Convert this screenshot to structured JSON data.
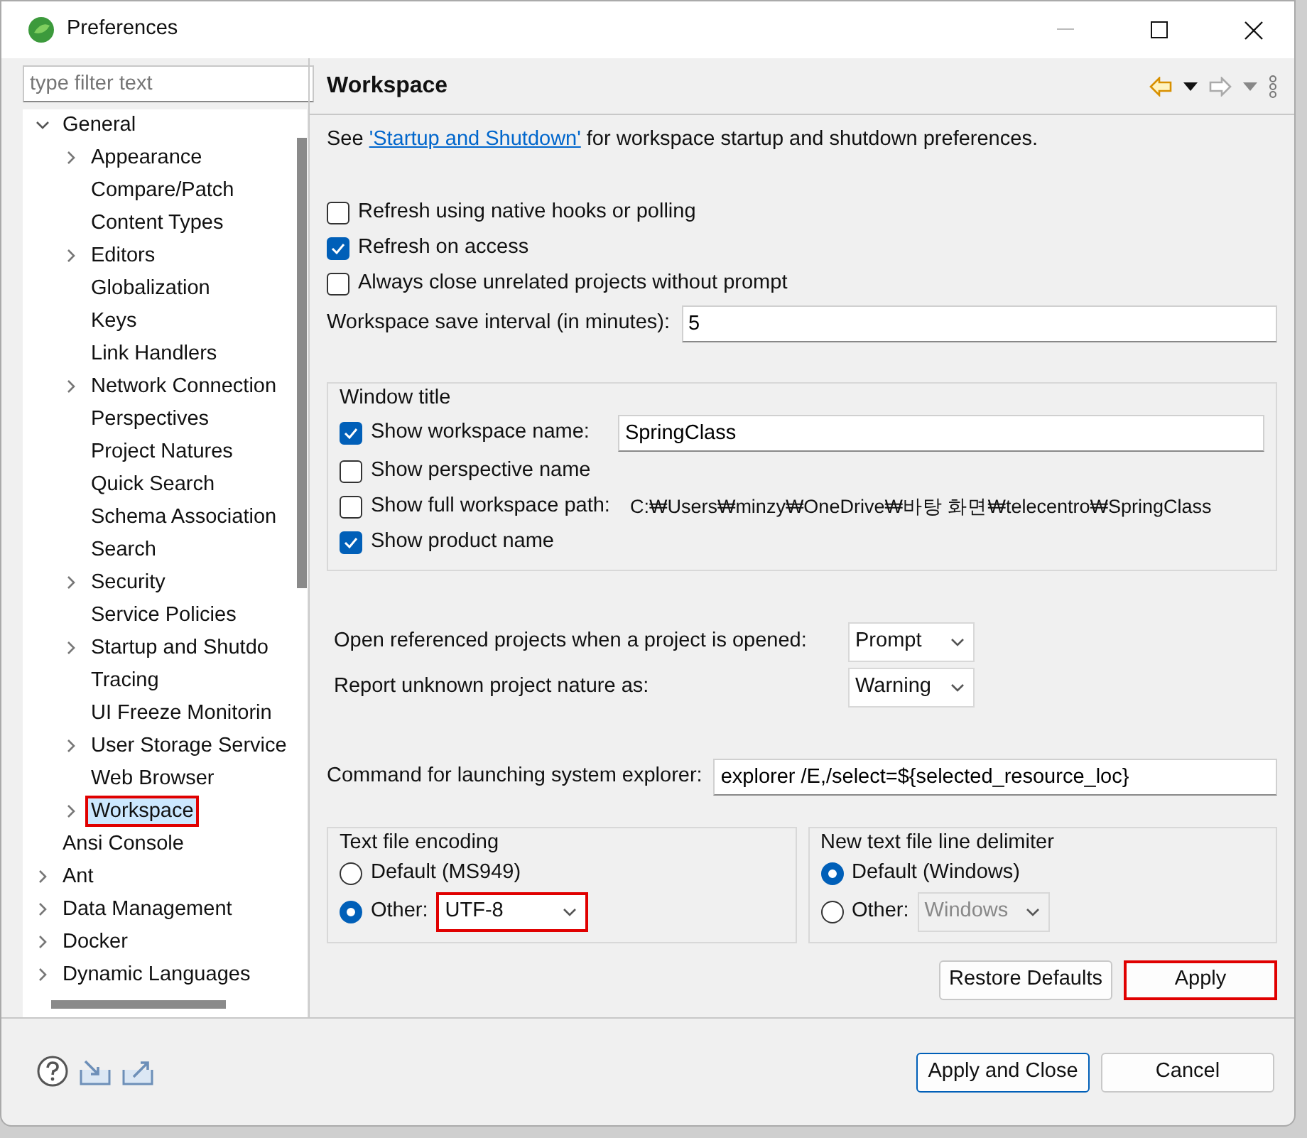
{
  "window": {
    "title": "Preferences"
  },
  "filter": {
    "placeholder": "type filter text"
  },
  "tree": [
    {
      "label": "General",
      "expandable": true,
      "expanded": true,
      "selected": false,
      "highlighted": false,
      "children": [
        {
          "label": "Appearance",
          "expandable": true,
          "expanded": false,
          "selected": false,
          "highlighted": false
        },
        {
          "label": "Compare/Patch",
          "expandable": false,
          "selected": false,
          "highlighted": false
        },
        {
          "label": "Content Types",
          "expandable": false,
          "selected": false,
          "highlighted": false
        },
        {
          "label": "Editors",
          "expandable": true,
          "expanded": false,
          "selected": false,
          "highlighted": false
        },
        {
          "label": "Globalization",
          "expandable": false,
          "selected": false,
          "highlighted": false
        },
        {
          "label": "Keys",
          "expandable": false,
          "selected": false,
          "highlighted": false
        },
        {
          "label": "Link Handlers",
          "expandable": false,
          "selected": false,
          "highlighted": false
        },
        {
          "label": "Network Connection",
          "expandable": true,
          "expanded": false,
          "selected": false,
          "highlighted": false
        },
        {
          "label": "Perspectives",
          "expandable": false,
          "selected": false,
          "highlighted": false
        },
        {
          "label": "Project Natures",
          "expandable": false,
          "selected": false,
          "highlighted": false
        },
        {
          "label": "Quick Search",
          "expandable": false,
          "selected": false,
          "highlighted": false
        },
        {
          "label": "Schema Association",
          "expandable": false,
          "selected": false,
          "highlighted": false
        },
        {
          "label": "Search",
          "expandable": false,
          "selected": false,
          "highlighted": false
        },
        {
          "label": "Security",
          "expandable": true,
          "expanded": false,
          "selected": false,
          "highlighted": false
        },
        {
          "label": "Service Policies",
          "expandable": false,
          "selected": false,
          "highlighted": false
        },
        {
          "label": "Startup and Shutdo",
          "expandable": true,
          "expanded": false,
          "selected": false,
          "highlighted": false
        },
        {
          "label": "Tracing",
          "expandable": false,
          "selected": false,
          "highlighted": false
        },
        {
          "label": "UI Freeze Monitorin",
          "expandable": false,
          "selected": false,
          "highlighted": false
        },
        {
          "label": "User Storage Service",
          "expandable": true,
          "expanded": false,
          "selected": false,
          "highlighted": false
        },
        {
          "label": "Web Browser",
          "expandable": false,
          "selected": false,
          "highlighted": false
        },
        {
          "label": "Workspace",
          "expandable": true,
          "expanded": false,
          "selected": true,
          "highlighted": true
        }
      ]
    },
    {
      "label": "Ansi Console",
      "expandable": false,
      "selected": false,
      "highlighted": false
    },
    {
      "label": "Ant",
      "expandable": true,
      "expanded": false,
      "selected": false,
      "highlighted": false
    },
    {
      "label": "Data Management",
      "expandable": true,
      "expanded": false,
      "selected": false,
      "highlighted": false
    },
    {
      "label": "Docker",
      "expandable": true,
      "expanded": false,
      "selected": false,
      "highlighted": false
    },
    {
      "label": "Dynamic Languages",
      "expandable": true,
      "expanded": false,
      "selected": false,
      "highlighted": false
    }
  ],
  "page": {
    "title": "Workspace",
    "intro": {
      "before": "See ",
      "link": "'Startup and Shutdown'",
      "after": " for workspace startup and shutdown preferences."
    },
    "options": [
      {
        "label": "Refresh using native hooks or polling",
        "checked": false
      },
      {
        "label": "Refresh on access",
        "checked": true
      },
      {
        "label": "Always close unrelated projects without prompt",
        "checked": false
      }
    ],
    "save_interval": {
      "label": "Workspace save interval (in minutes):",
      "value": "5"
    },
    "window_title": {
      "title": "Window title",
      "rows": [
        {
          "kind": "field",
          "label": "Show workspace name:",
          "checked": true,
          "value": "SpringClass"
        },
        {
          "kind": "plain",
          "label": "Show perspective name",
          "checked": false
        },
        {
          "kind": "path",
          "label": "Show full workspace path:",
          "checked": false,
          "value": "C:₩Users₩minzy₩OneDrive₩바탕 화면₩telecentro₩SpringClass"
        },
        {
          "kind": "plain",
          "label": "Show product name",
          "checked": true
        }
      ]
    },
    "dropdowns": [
      {
        "label": "Open referenced projects when a project is opened:",
        "value": "Prompt"
      },
      {
        "label": "Report unknown project nature as:",
        "value": "Warning"
      }
    ],
    "command": {
      "label": "Command for launching system explorer:",
      "value": "explorer /E,/select=${selected_resource_loc}"
    },
    "groups": [
      {
        "title": "Text file encoding",
        "options": [
          {
            "label": "Default (MS949)",
            "selected": false
          },
          {
            "label": "Other:",
            "selected": true,
            "value": "UTF-8",
            "disabled": false,
            "highlighted": true
          }
        ]
      },
      {
        "title": "New text file line delimiter",
        "options": [
          {
            "label": "Default (Windows)",
            "selected": true
          },
          {
            "label": "Other:",
            "selected": false,
            "value": "Windows",
            "disabled": true,
            "highlighted": false
          }
        ]
      }
    ],
    "buttons": [
      {
        "label": "Restore Defaults",
        "highlighted": false
      },
      {
        "label": "Apply",
        "highlighted": true
      }
    ]
  },
  "footer_buttons": [
    {
      "label": "Apply and Close",
      "default": true
    },
    {
      "label": "Cancel",
      "default": false
    }
  ]
}
